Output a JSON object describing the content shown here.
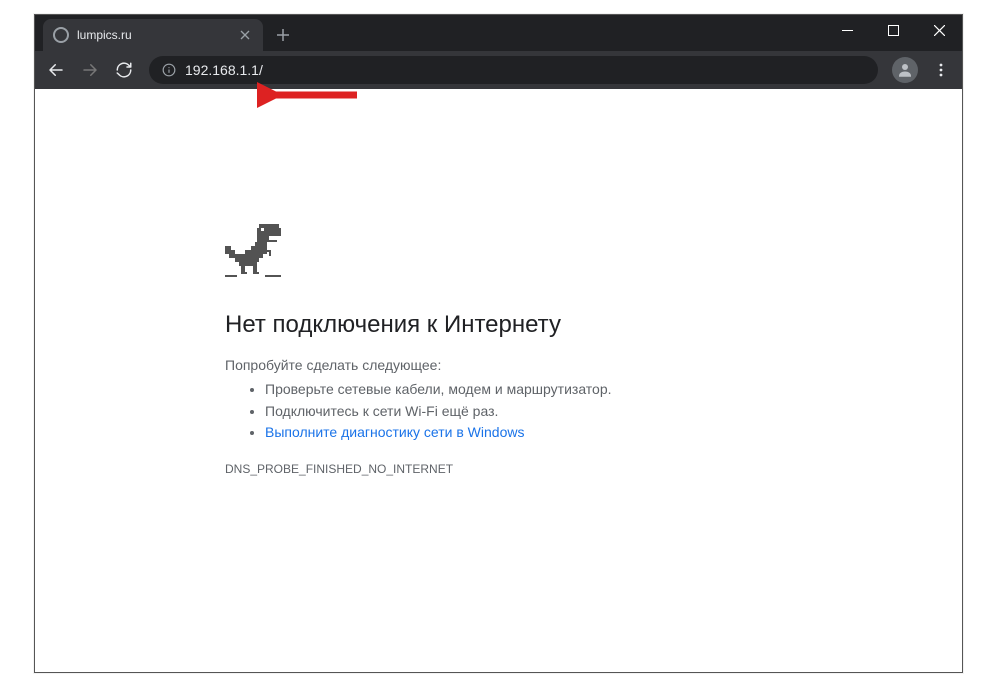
{
  "tab": {
    "title": "lumpics.ru"
  },
  "omnibox": {
    "url": "192.168.1.1/"
  },
  "error": {
    "title": "Нет подключения к Интернету",
    "subtitle": "Попробуйте сделать следующее:",
    "items": [
      "Проверьте сетевые кабели, модем и маршрутизатор.",
      "Подключитесь к сети Wi-Fi ещё раз."
    ],
    "link": "Выполните диагностику сети в Windows",
    "code": "DNS_PROBE_FINISHED_NO_INTERNET"
  }
}
